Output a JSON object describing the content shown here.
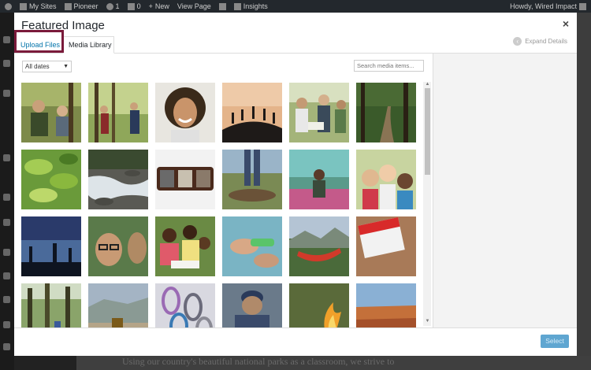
{
  "adminbar": {
    "my_sites": "My Sites",
    "site_name": "Pioneer",
    "updates": "1",
    "comments": "0",
    "new": "New",
    "view_page": "View Page",
    "insights": "Insights",
    "greeting": "Howdy, Wired Impact"
  },
  "modal": {
    "title": "Featured Image",
    "close_label": "×",
    "tabs": [
      {
        "label": "Upload Files"
      },
      {
        "label": "Media Library"
      }
    ],
    "expand_details": "Expand Details"
  },
  "toolbar": {
    "date_filter": "All dates",
    "search_placeholder": "Search media items..."
  },
  "grid": {
    "items": [
      {
        "icon": "family-hiking-photo"
      },
      {
        "icon": "people-hiking-woods-photo"
      },
      {
        "icon": "smiling-woman-portrait-photo"
      },
      {
        "icon": "silhouettes-hill-sunset-photo"
      },
      {
        "icon": "group-map-reading-photo"
      },
      {
        "icon": "forest-trail-photo"
      },
      {
        "icon": "green-leaves-photo"
      },
      {
        "icon": "river-rapids-photo"
      },
      {
        "icon": "wooden-plaque-photo"
      },
      {
        "icon": "feet-on-log-photo"
      },
      {
        "icon": "hiker-wildflowers-photo"
      },
      {
        "icon": "smiling-kids-photo"
      },
      {
        "icon": "silhouette-hikers-dusk-photo"
      },
      {
        "icon": "girl-glasses-forest-photo"
      },
      {
        "icon": "children-group-activity-photo"
      },
      {
        "icon": "hands-water-sample-photo"
      },
      {
        "icon": "hammock-mountains-photo"
      },
      {
        "icon": "red-first-aid-kit-photo"
      },
      {
        "icon": "forest-hiker-photo"
      },
      {
        "icon": "road-bus-valley-photo"
      },
      {
        "icon": "carabiners-climbing-gear-photo"
      },
      {
        "icon": "person-cap-back-photo"
      },
      {
        "icon": "campfire-photo"
      },
      {
        "icon": "red-rock-canyon-photo"
      }
    ]
  },
  "footer": {
    "select_label": "Select"
  },
  "background": {
    "text": "Using our country's beautiful national parks as a classroom, we strive to"
  },
  "colors": {
    "link_blue": "#0073aa",
    "highlight_border": "#7a1a3a",
    "select_button": "#5fa6d1"
  }
}
